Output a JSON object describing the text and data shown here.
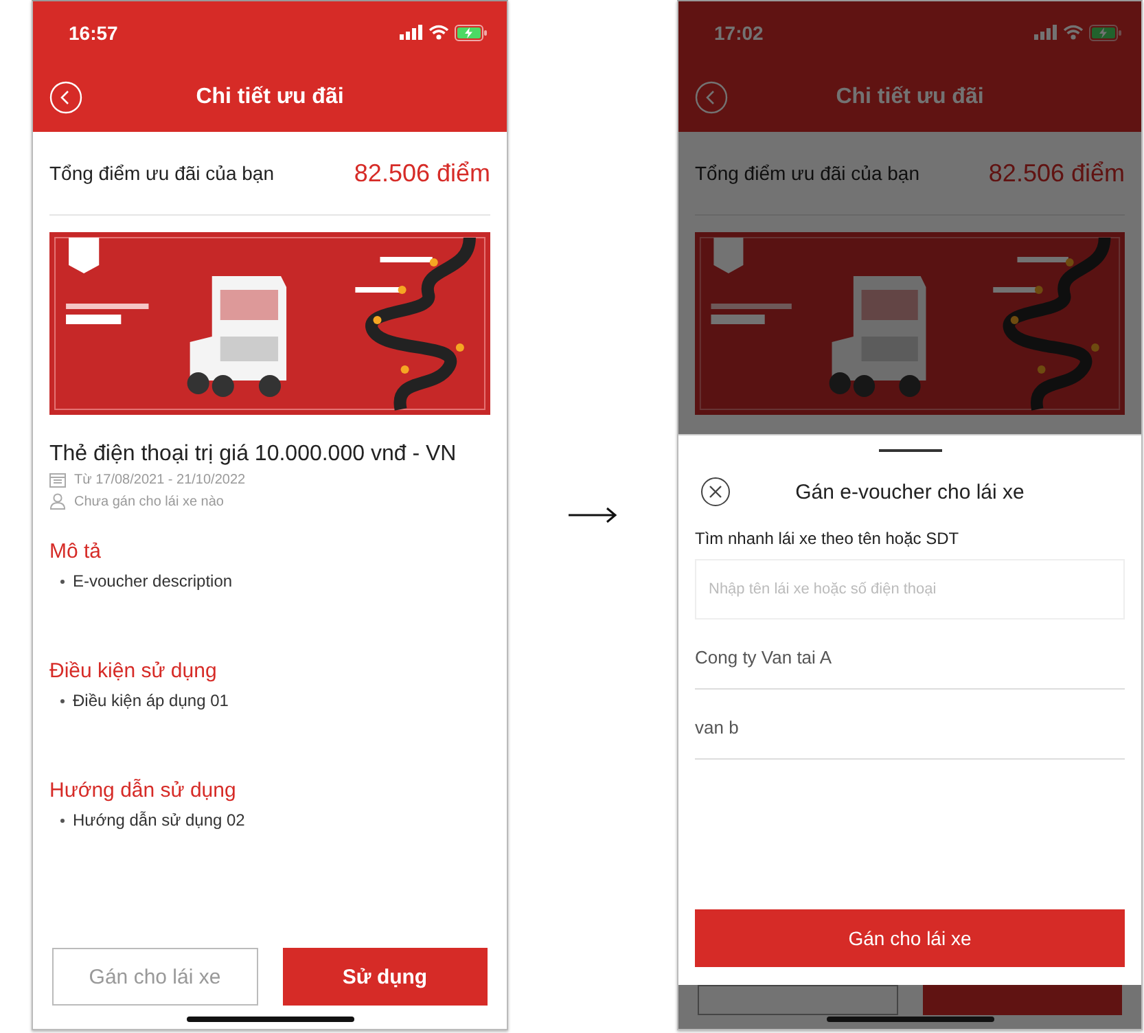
{
  "detail_screen": {
    "status_bar": {
      "time": "16:57"
    },
    "header": {
      "title": "Chi tiết ưu đãi"
    },
    "points": {
      "label": "Tổng điểm ưu đãi của bạn",
      "value": "82.506 điểm"
    },
    "voucher": {
      "title": "Thẻ điện thoại trị giá 10.000.000  vnđ - VN",
      "validity": "Từ 17/08/2021 - 21/10/2022",
      "assignee": "Chưa gán cho lái xe nào"
    },
    "sections": [
      {
        "heading": "Mô tả",
        "items": [
          "E-voucher description"
        ]
      },
      {
        "heading": "Điều kiện sử dụng",
        "items": [
          "Điều kiện áp dụng 01"
        ]
      },
      {
        "heading": "Hướng dẫn sử dụng",
        "items": [
          "Hướng dẫn sử dụng 02"
        ]
      }
    ],
    "buttons": [
      {
        "label": "Gán cho lái xe",
        "kind": "outline"
      },
      {
        "label": "Sử dụng",
        "kind": "primary"
      }
    ]
  },
  "assign_screen": {
    "status_bar": {
      "time": "17:02"
    },
    "header": {
      "title": "Chi tiết ưu đãi"
    },
    "points": {
      "label": "Tổng điểm ưu đãi của bạn",
      "value": "82.506 điểm"
    },
    "sheet": {
      "title": "Gán e-voucher cho lái xe",
      "search_label": "Tìm nhanh lái xe theo tên hoặc SDT",
      "search": {
        "placeholder": "Nhập tên lái xe hoặc số điện thoại"
      },
      "drivers": [
        "Cong ty Van tai A",
        "van b"
      ],
      "button": "Gán cho lái xe"
    }
  }
}
